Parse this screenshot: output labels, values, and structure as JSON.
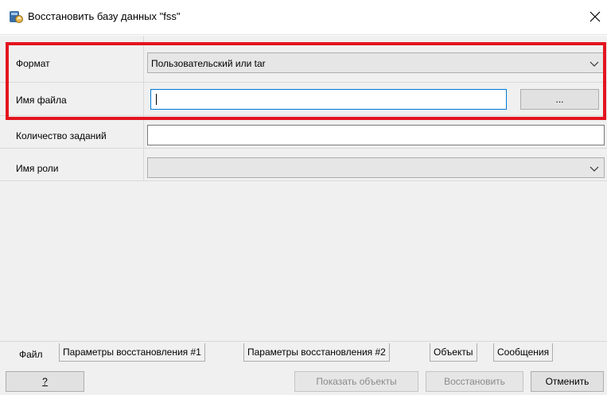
{
  "window": {
    "title": "Восстановить базу данных \"fss\"",
    "close_label": "✕",
    "app_icon": "pgadmin-restore-icon"
  },
  "form": {
    "format": {
      "label": "Формат",
      "value": "Пользовательский или tar"
    },
    "filename": {
      "label": "Имя файла",
      "value": "",
      "browse_label": "..."
    },
    "jobs": {
      "label": "Количество заданий",
      "value": ""
    },
    "role": {
      "label": "Имя роли",
      "value": ""
    }
  },
  "tabs": [
    {
      "label": "Файл",
      "active": true
    },
    {
      "label": "Параметры восстановления #1",
      "active": false
    },
    {
      "label": "Параметры восстановления #2",
      "active": false
    },
    {
      "label": "Объекты",
      "active": false
    },
    {
      "label": "Сообщения",
      "active": false
    }
  ],
  "buttons": {
    "help": "?",
    "show_objects": "Показать объекты",
    "restore": "Восстановить",
    "cancel": "Отменить"
  },
  "colors": {
    "highlight": "#e3141f",
    "focus_border": "#0078d7",
    "panel_bg": "#f0f0f0"
  }
}
